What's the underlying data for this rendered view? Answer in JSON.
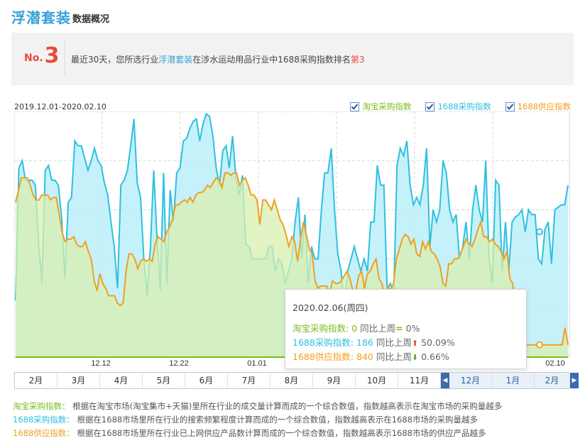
{
  "header": {
    "keyword": "浮潜套装",
    "subtitle": "数据概况"
  },
  "rank": {
    "prefix": "No.",
    "number": "3",
    "text_1": "最近30天，您所选行业",
    "text_keyword": "浮潜套装",
    "text_2": "在涉水运动用品行业中1688采购指数排名",
    "text_rank": "第3"
  },
  "date_range": "2019.12.01-2020.02.10",
  "legend": [
    {
      "label": "淘宝采购指数",
      "color": "#7cbb1f",
      "checked": true
    },
    {
      "label": "1688采购指数",
      "color": "#2ec0e0",
      "checked": true
    },
    {
      "label": "1688供应指数",
      "color": "#f0a020",
      "checked": true
    }
  ],
  "chart_data": {
    "type": "area",
    "x_range": [
      "2019-12-01",
      "2020-02-10"
    ],
    "x_tick_labels": [
      "12.12",
      "12.22",
      "01.01",
      "02.10"
    ],
    "ylim": [
      0,
      100
    ],
    "grid": true,
    "series": [
      {
        "name": "1688采购指数",
        "color": "#2ec0e0",
        "values": [
          23,
          77,
          80,
          72,
          72,
          72,
          70,
          46,
          30,
          76,
          78,
          72,
          72,
          70,
          57,
          32,
          63,
          65,
          88,
          86,
          86,
          81,
          76,
          80,
          85,
          80,
          78,
          71,
          66,
          55,
          45,
          28,
          70,
          72,
          76,
          86,
          97,
          71,
          65,
          40,
          25,
          45,
          76,
          49,
          27,
          75,
          30,
          68,
          55,
          75,
          77,
          88,
          89,
          93,
          96,
          97,
          88,
          95,
          99,
          98,
          90,
          77,
          70,
          84,
          86,
          77,
          90,
          73,
          66,
          74,
          46,
          45,
          40,
          40,
          40,
          40,
          40,
          45,
          45,
          35,
          40,
          38,
          30,
          35,
          40,
          55,
          65,
          40,
          58,
          30,
          45,
          40,
          40,
          60,
          75,
          75,
          85,
          60,
          42,
          35,
          20,
          35,
          40,
          45,
          40,
          35,
          40,
          35,
          55,
          55,
          78,
          70,
          70,
          28,
          30,
          25,
          78,
          85,
          82,
          88,
          70,
          62,
          65,
          62,
          70,
          85,
          45,
          60,
          55,
          60,
          80,
          75,
          60,
          55,
          58,
          40,
          45,
          55,
          40,
          60,
          70,
          60,
          55,
          80,
          40,
          30,
          72,
          70,
          35,
          55,
          35,
          55,
          57,
          58,
          60,
          51,
          60,
          58,
          58,
          40,
          38,
          52,
          55,
          38,
          60,
          61,
          62,
          62,
          70
        ]
      },
      {
        "name": "1688供应指数",
        "color": "#f0a020",
        "values": [
          63,
          68,
          73,
          73,
          73,
          70,
          66,
          64,
          64,
          66,
          66,
          66,
          64,
          65,
          65,
          58,
          51,
          47,
          48,
          48,
          49,
          46,
          45,
          45,
          47,
          43,
          40,
          31,
          27,
          34,
          30,
          28,
          25,
          25,
          25,
          22,
          21,
          22,
          35,
          42,
          42,
          40,
          36,
          39,
          40,
          39,
          40,
          39,
          46,
          49,
          48,
          47,
          51,
          53,
          56,
          62,
          62,
          63,
          64,
          63,
          65,
          63,
          66,
          67,
          67,
          68,
          70,
          69,
          71,
          73,
          72,
          69,
          75,
          75,
          74,
          75,
          75,
          70,
          72,
          73,
          70,
          66,
          66,
          64,
          54,
          64,
          64,
          62,
          60,
          64,
          60,
          56,
          54,
          50,
          45,
          49,
          47,
          39,
          48,
          55,
          50,
          44,
          42,
          31,
          28,
          29,
          29,
          29,
          26,
          31,
          30,
          30,
          31,
          33,
          35,
          32,
          27,
          27,
          33,
          35,
          28,
          34,
          35,
          38,
          40,
          32,
          30,
          25,
          29,
          27,
          30,
          40,
          44,
          48,
          50,
          49,
          46,
          48,
          42,
          41,
          47,
          44,
          47,
          43,
          42,
          40,
          37,
          30,
          29,
          38,
          38,
          40,
          40,
          42,
          45,
          48,
          46,
          45,
          48,
          52,
          55,
          49,
          49,
          47,
          48,
          46,
          45,
          43,
          40,
          43,
          32,
          30,
          18,
          12,
          6,
          5,
          5,
          5,
          5,
          5,
          5,
          5,
          5,
          5,
          5,
          5,
          5,
          5,
          5,
          12,
          5
        ]
      },
      {
        "name": "淘宝采购指数",
        "color": "#7cbb1f",
        "values": [
          0,
          0,
          0,
          0,
          0,
          0,
          0,
          0,
          0,
          0
        ]
      }
    ]
  },
  "tooltip": {
    "date": "2020.02.06(周四)",
    "rows": [
      {
        "label": "淘宝采购指数",
        "value": "0",
        "compare": "同比上周",
        "delta": "0%"
      },
      {
        "label": "1688采购指数",
        "value": "186",
        "compare": "同比上周",
        "delta": "50.09%"
      },
      {
        "label": "1688供应指数",
        "value": "840",
        "compare": "同比上周",
        "delta": "0.66%"
      }
    ]
  },
  "months": [
    "2月",
    "3月",
    "4月",
    "5月",
    "6月",
    "7月",
    "8月",
    "9月",
    "10月",
    "11月",
    "12月",
    "1月",
    "2月"
  ],
  "notes": [
    {
      "term": "淘宝采购指数：",
      "desc": "根据在淘宝市场(淘宝集市+天猫)里所在行业的成交量计算而成的一个综合数值，指数越高表示在淘宝市场的采购量越多"
    },
    {
      "term": "1688采购指数：",
      "desc": "根据在1688市场里所在行业的搜索频繁程度计算而成的一个综合数值，指数越高表示在1688市场的采购量越多"
    },
    {
      "term": "1688供应指数：",
      "desc": "根据在1688市场里所在行业已上网供应产品数计算而成的一个综合数值，指数越高表示1688市场的供应产品越多"
    }
  ]
}
